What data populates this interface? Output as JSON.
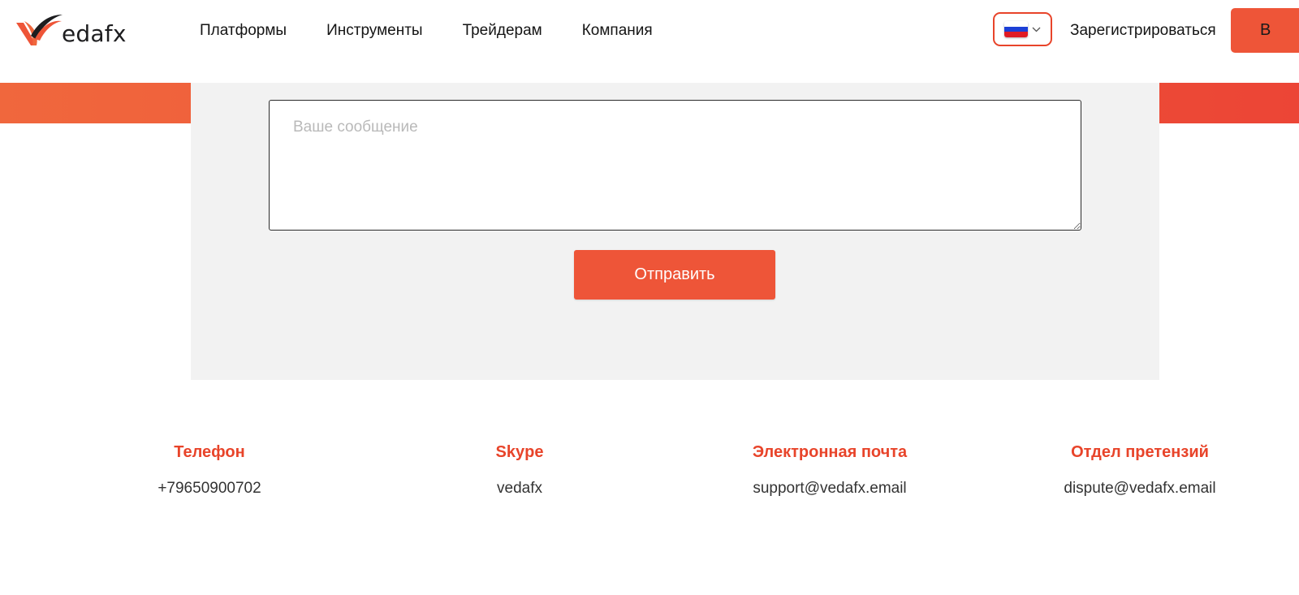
{
  "brand": {
    "logo_text": "edafx",
    "accent_color": "#ee5538",
    "title_color": "#e8442a",
    "panel_color": "#f2f2f2"
  },
  "nav": {
    "items": [
      {
        "label": "Платформы"
      },
      {
        "label": "Инструменты"
      },
      {
        "label": "Трейдерам"
      },
      {
        "label": "Компания"
      }
    ]
  },
  "header": {
    "language_flag": "russia-flag-icon",
    "register_label": "Зарегистрироваться",
    "login_label": "В"
  },
  "form": {
    "message_placeholder": "Ваше сообщение",
    "message_value": "",
    "submit_label": "Отправить"
  },
  "contacts": [
    {
      "title": "Телефон",
      "value": "+79650900702"
    },
    {
      "title": "Skype",
      "value": "vedafx"
    },
    {
      "title": "Электронная почта",
      "value": "support@vedafx.email"
    },
    {
      "title": "Отдел претензий",
      "value": "dispute@vedafx.email"
    }
  ]
}
